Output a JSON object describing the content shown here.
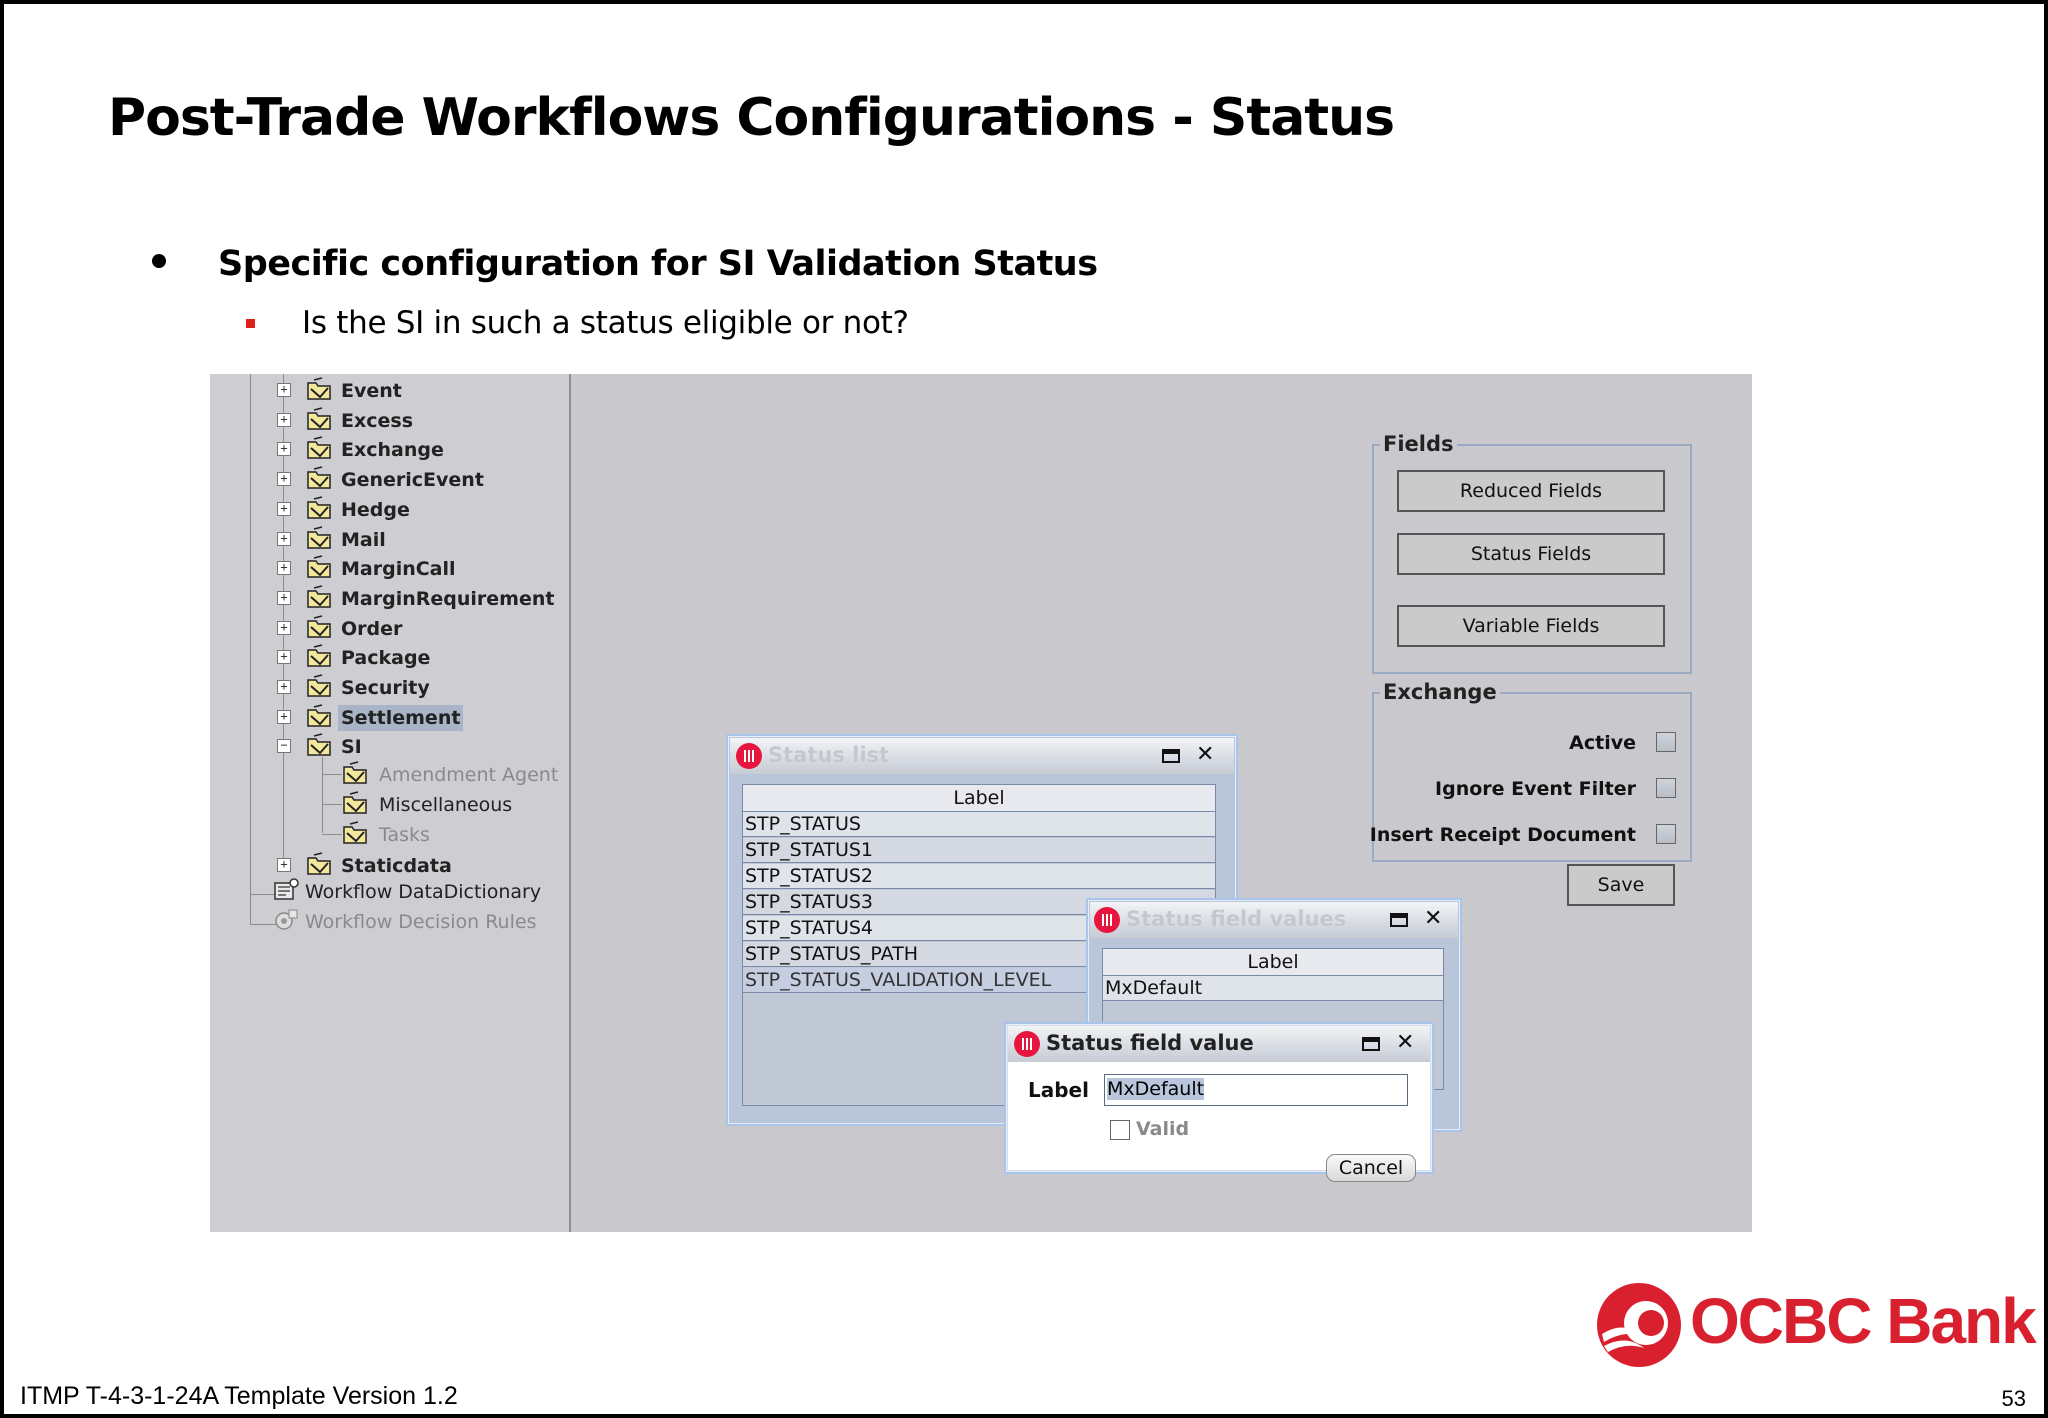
{
  "slide": {
    "title": "Post-Trade Workflows Configurations - Status",
    "bullet_main": "Specific configuration for SI Validation Status",
    "bullet_sub": "Is the SI in such a status eligible or not?",
    "footer_template": "ITMP T-4-3-1-24A Template Version 1.2",
    "page_number": "53",
    "logo_text": "OCBC Bank"
  },
  "tree": {
    "nodes": [
      {
        "label": "Event",
        "state": "collapsed"
      },
      {
        "label": "Excess",
        "state": "collapsed"
      },
      {
        "label": "Exchange",
        "state": "collapsed"
      },
      {
        "label": "GenericEvent",
        "state": "collapsed"
      },
      {
        "label": "Hedge",
        "state": "collapsed"
      },
      {
        "label": "Mail",
        "state": "collapsed"
      },
      {
        "label": "MarginCall",
        "state": "collapsed"
      },
      {
        "label": "MarginRequirement",
        "state": "collapsed"
      },
      {
        "label": "Order",
        "state": "collapsed"
      },
      {
        "label": "Package",
        "state": "collapsed"
      },
      {
        "label": "Security",
        "state": "collapsed"
      },
      {
        "label": "Settlement",
        "state": "collapsed",
        "selected": true
      },
      {
        "label": "SI",
        "state": "expanded"
      },
      {
        "label": "Staticdata",
        "state": "collapsed"
      }
    ],
    "si_children": [
      {
        "label": "Amendment Agent",
        "enabled": false
      },
      {
        "label": "Miscellaneous",
        "enabled": true
      },
      {
        "label": "Tasks",
        "enabled": false
      }
    ],
    "root_items": [
      {
        "label": "Workflow DataDictionary",
        "enabled": true
      },
      {
        "label": "Workflow Decision Rules",
        "enabled": false
      }
    ]
  },
  "fields_group": {
    "title": "Fields",
    "buttons": [
      "Reduced Fields",
      "Status Fields",
      "Variable Fields"
    ]
  },
  "exchange_group": {
    "title": "Exchange",
    "checkboxes": [
      {
        "label": "Active",
        "checked": false
      },
      {
        "label": "Ignore Event Filter",
        "checked": false
      },
      {
        "label": "Insert Receipt Document",
        "checked": false
      }
    ],
    "save_label": "Save"
  },
  "status_list_dialog": {
    "title": "Status list",
    "column_header": "Label",
    "rows": [
      "STP_STATUS",
      "STP_STATUS1",
      "STP_STATUS2",
      "STP_STATUS3",
      "STP_STATUS4",
      "STP_STATUS_PATH",
      "STP_STATUS_VALIDATION_LEVEL"
    ],
    "selected_row": "STP_STATUS_VALIDATION_LEVEL"
  },
  "status_field_values_dialog": {
    "title": "Status field values",
    "column_header": "Label",
    "rows": [
      "MxDefault"
    ]
  },
  "status_field_value_dialog": {
    "title": "Status field value",
    "label_caption": "Label",
    "label_value": "MxDefault",
    "valid_label": "Valid",
    "valid_checked": false,
    "cancel_label": "Cancel"
  },
  "colors": {
    "ocbc_red": "#d9202f",
    "bullet_red": "#e0201a",
    "app_background": "#c8c8cd",
    "dialog_frame": "#a9c4ea"
  },
  "icons": {
    "tree_node": "workflow-folder-icon",
    "data_dictionary": "data-dictionary-icon",
    "decision_rules": "decision-rules-icon",
    "dialog_app": "murex-app-icon",
    "maximize": "maximize-icon",
    "close": "close-icon"
  }
}
